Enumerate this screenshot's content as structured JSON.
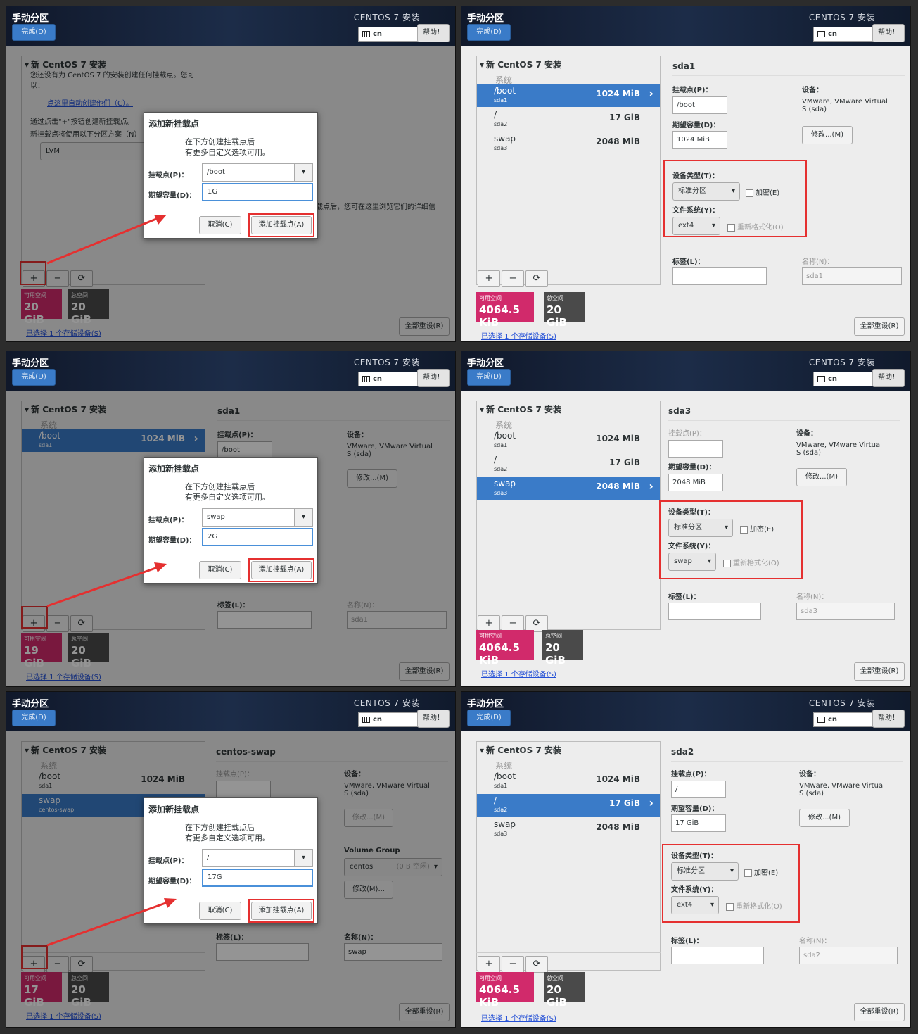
{
  "common": {
    "title": "手动分区",
    "done": "完成(D)",
    "product": "CENTOS 7 安装",
    "keyboard": "cn",
    "help": "帮助！",
    "tree_header": "新 CentOS 7 安装",
    "system": "系统",
    "avail_label": "可用空间",
    "total_label": "总空间",
    "total_value": "20 GiB",
    "storage_link": "已选择 1 个存储设备(S)",
    "reset": "全部重设(R)",
    "mount_label": "挂载点(P)：",
    "capacity_label": "期望容量(D)：",
    "device_label": "设备：",
    "device_value": "VMware, VMware Virtual S (sda)",
    "modify": "修改...(M)",
    "devtype_label": "设备类型(T)：",
    "devtype_value": "标准分区",
    "encrypt": "加密(E)",
    "fs_label": "文件系统(Y)：",
    "reformat": "重新格式化(O)",
    "tag_label": "标签(L)：",
    "name_label": "名称(N)：",
    "plus": "+",
    "minus": "−",
    "refresh": "⟳"
  },
  "dialog": {
    "title": "添加新挂载点",
    "desc1": "在下方创建挂载点后",
    "desc2": "有更多自定义选项可用。",
    "mount_label": "挂载点(P)：",
    "capacity_label": "期望容量(D)：",
    "cancel": "取消(C)",
    "add": "添加挂载点(A)"
  },
  "p1": {
    "intro1": "您还没有为 CentOS 7 的安装创建任何挂载点。您可",
    "intro2": "以：",
    "auto_link": "点这里自动创建他们（C）。",
    "bullet2": "通过点击\"+\"按钮创建新挂载点。",
    "scheme": "新挂载点将使用以下分区方案（N）",
    "scheme_value": "LVM",
    "browse": "载点后，您可在这里浏览它们的详细信",
    "avail": "20 GiB",
    "mount": "/boot",
    "cap": "1G"
  },
  "p2": {
    "dev": "sda1",
    "mount": "/boot",
    "cap": "1024 MiB",
    "fs": "ext4",
    "name": "sda1",
    "avail": "4064.5 KiB"
  },
  "p3": {
    "dev": "sda1",
    "mount": "/boot",
    "avail": "19 GiB",
    "dmount": "swap",
    "dcap": "2G",
    "name": "sda1"
  },
  "p4": {
    "dev": "sda3",
    "cap": "2048 MiB",
    "fs": "swap",
    "name": "sda3",
    "avail": "4064.5 KiB"
  },
  "p5": {
    "dev": "centos-swap",
    "avail": "17 GiB",
    "vg_label": "Volume Group",
    "vg_value": "centos",
    "vg_free": "(0 B 空闲)",
    "vg_modify": "修改(M)...",
    "name": "swap",
    "dmount": "/",
    "dcap": "17G"
  },
  "p6": {
    "dev": "sda2",
    "mount": "/",
    "cap": "17 GiB",
    "fs": "ext4",
    "name": "sda2",
    "avail": "4064.5 KiB"
  },
  "rows": {
    "boot": {
      "m": "/boot",
      "d": "sda1",
      "s": "1024 MiB"
    },
    "root": {
      "m": "/",
      "d": "sda2",
      "s": "17 GiB"
    },
    "swap": {
      "m": "swap",
      "d": "sda3",
      "s": "2048 MiB"
    },
    "lvswap": {
      "m": "swap",
      "d": "centos-swap"
    }
  }
}
